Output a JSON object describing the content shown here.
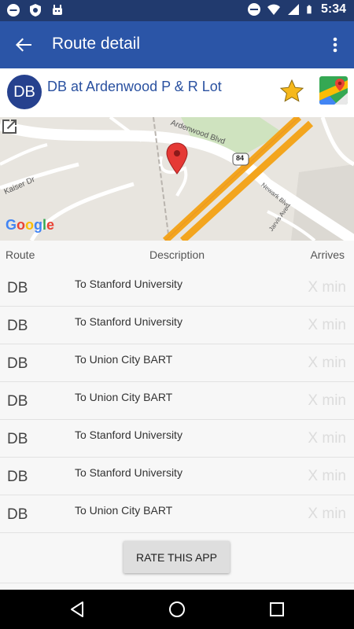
{
  "status_bar": {
    "time": "5:34",
    "left_icons": [
      "minus-circle-icon",
      "shield-icon",
      "android-icon"
    ],
    "right_icons": [
      "do-not-disturb-icon",
      "wifi-icon",
      "signal-icon",
      "battery-icon"
    ]
  },
  "app_bar": {
    "title": "Route detail",
    "back_icon": "arrow-back-icon",
    "overflow_icon": "more-vert-icon",
    "color": "#2b55a7"
  },
  "stop": {
    "route_badge": "DB",
    "name": "DB at Ardenwood P & R Lot",
    "favorite_icon": "star-icon",
    "maps_icon": "google-maps-icon"
  },
  "map": {
    "street_labels": [
      "Ardenwood Blvd",
      "Kaiser Dr",
      "Newark Blvd",
      "Jarvis Ave"
    ],
    "highway_shield": "84",
    "provider_logo": "Google",
    "open_icon": "open-external-icon"
  },
  "table": {
    "headers": {
      "route": "Route",
      "description": "Description",
      "arrives": "Arrives"
    },
    "rows": [
      {
        "route": "DB",
        "description": "To Stanford University",
        "arrives": "X min"
      },
      {
        "route": "DB",
        "description": "To Stanford University",
        "arrives": "X min"
      },
      {
        "route": "DB",
        "description": "To Union City BART",
        "arrives": "X min"
      },
      {
        "route": "DB",
        "description": "To Union City BART",
        "arrives": "X min"
      },
      {
        "route": "DB",
        "description": "To Stanford University",
        "arrives": "X min"
      },
      {
        "route": "DB",
        "description": "To Stanford University",
        "arrives": "X min"
      },
      {
        "route": "DB",
        "description": "To Union City BART",
        "arrives": "X min"
      }
    ]
  },
  "rate_button": {
    "label": "RATE THIS APP"
  },
  "nav_bar": {
    "icons": [
      "nav-back-icon",
      "nav-home-icon",
      "nav-recents-icon"
    ]
  }
}
